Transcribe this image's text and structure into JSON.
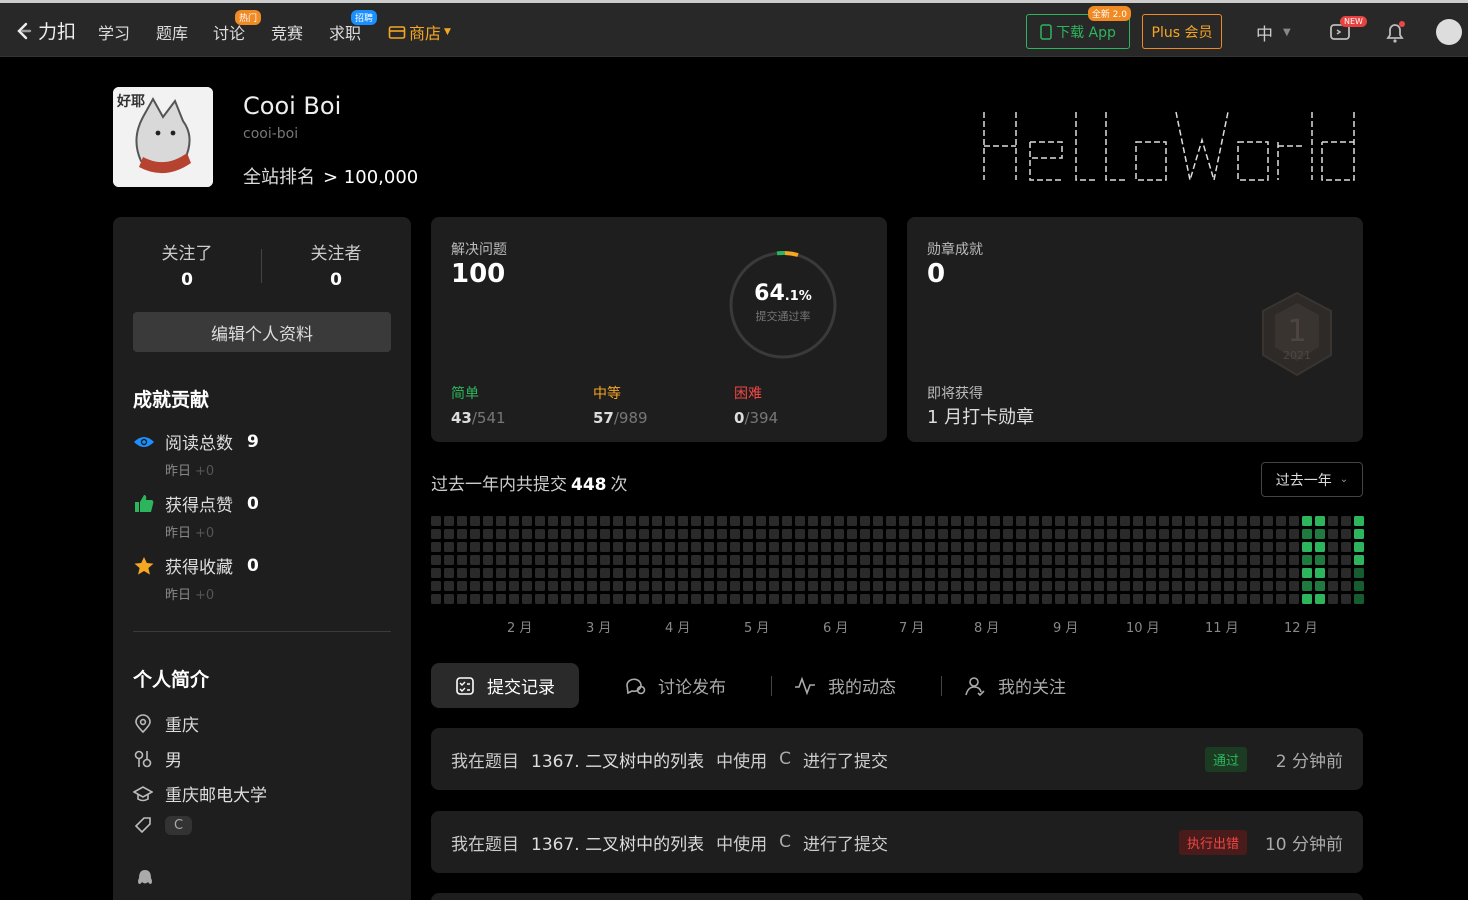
{
  "nav": {
    "logo": "力扣",
    "items": [
      {
        "label": "学习"
      },
      {
        "label": "题库"
      },
      {
        "label": "讨论",
        "badge": "热门"
      },
      {
        "label": "竞赛"
      },
      {
        "label": "求职",
        "badge": "招聘"
      }
    ],
    "shop": "商店",
    "download_app": "下载 App",
    "download_tag": "全新 2.0",
    "plus": "Plus 会员",
    "language": "中",
    "new_badge": "NEW"
  },
  "profile": {
    "name": "Cooi Boi",
    "slug": "cooi-boi",
    "avatar_text": "好耶",
    "rank_label": "全站排名",
    "rank_value": "> 100,000"
  },
  "left": {
    "following_label": "关注了",
    "following": "0",
    "followers_label": "关注者",
    "followers": "0",
    "edit_button": "编辑个人资料",
    "contrib_title": "成就贡献",
    "contrib": [
      {
        "label": "阅读总数",
        "value": "9",
        "sub": "昨日",
        "delta": "+0",
        "icon": "eye-icon",
        "color": "#1a90ff"
      },
      {
        "label": "获得点赞",
        "value": "0",
        "sub": "昨日",
        "delta": "+0",
        "icon": "thumbs-up-icon",
        "color": "#2db55d"
      },
      {
        "label": "获得收藏",
        "value": "0",
        "sub": "昨日",
        "delta": "+0",
        "icon": "star-icon",
        "color": "#f5a623"
      }
    ],
    "intro_title": "个人简介",
    "location": "重庆",
    "gender": "男",
    "school": "重庆邮电大学",
    "skill": "C"
  },
  "solved": {
    "label": "解决问题",
    "value": "100",
    "rate": "64",
    "rate_decimal": ".1%",
    "rate_label": "提交通过率",
    "easy_label": "简单",
    "easy": "43",
    "easy_total": "/541",
    "medium_label": "中等",
    "medium": "57",
    "medium_total": "/989",
    "hard_label": "困难",
    "hard": "0",
    "hard_total": "/394",
    "colors": {
      "easy": "#2db55d",
      "medium": "#f5a623",
      "hard": "#ef4743"
    }
  },
  "badges": {
    "label": "勋章成就",
    "value": "0",
    "upcoming_label": "即将获得",
    "upcoming": "1 月打卡勋章",
    "badge_year": "2021",
    "badge_num": "1"
  },
  "activity": {
    "prefix": "过去一年内共提交",
    "count": "448",
    "suffix": "次",
    "range_select": "过去一年",
    "months": [
      "2 月",
      "3 月",
      "4 月",
      "5 月",
      "6 月",
      "7 月",
      "8 月",
      "9 月",
      "10 月",
      "11 月",
      "12 月"
    ]
  },
  "tabs": [
    {
      "label": "提交记录",
      "icon": "checklist-icon"
    },
    {
      "label": "讨论发布",
      "icon": "discussion-icon"
    },
    {
      "label": "我的动态",
      "icon": "activity-icon"
    },
    {
      "label": "我的关注",
      "icon": "user-icon"
    }
  ],
  "submissions": [
    {
      "prefix": "我在题目",
      "title": "1367. 二叉树中的列表",
      "mid": "中使用",
      "lang": "C",
      "suffix": "进行了提交",
      "status": "通过",
      "time": "2 分钟前"
    },
    {
      "prefix": "我在题目",
      "title": "1367. 二叉树中的列表",
      "mid": "中使用",
      "lang": "C",
      "suffix": "进行了提交",
      "status": "执行出错",
      "time": "10 分钟前"
    }
  ]
}
